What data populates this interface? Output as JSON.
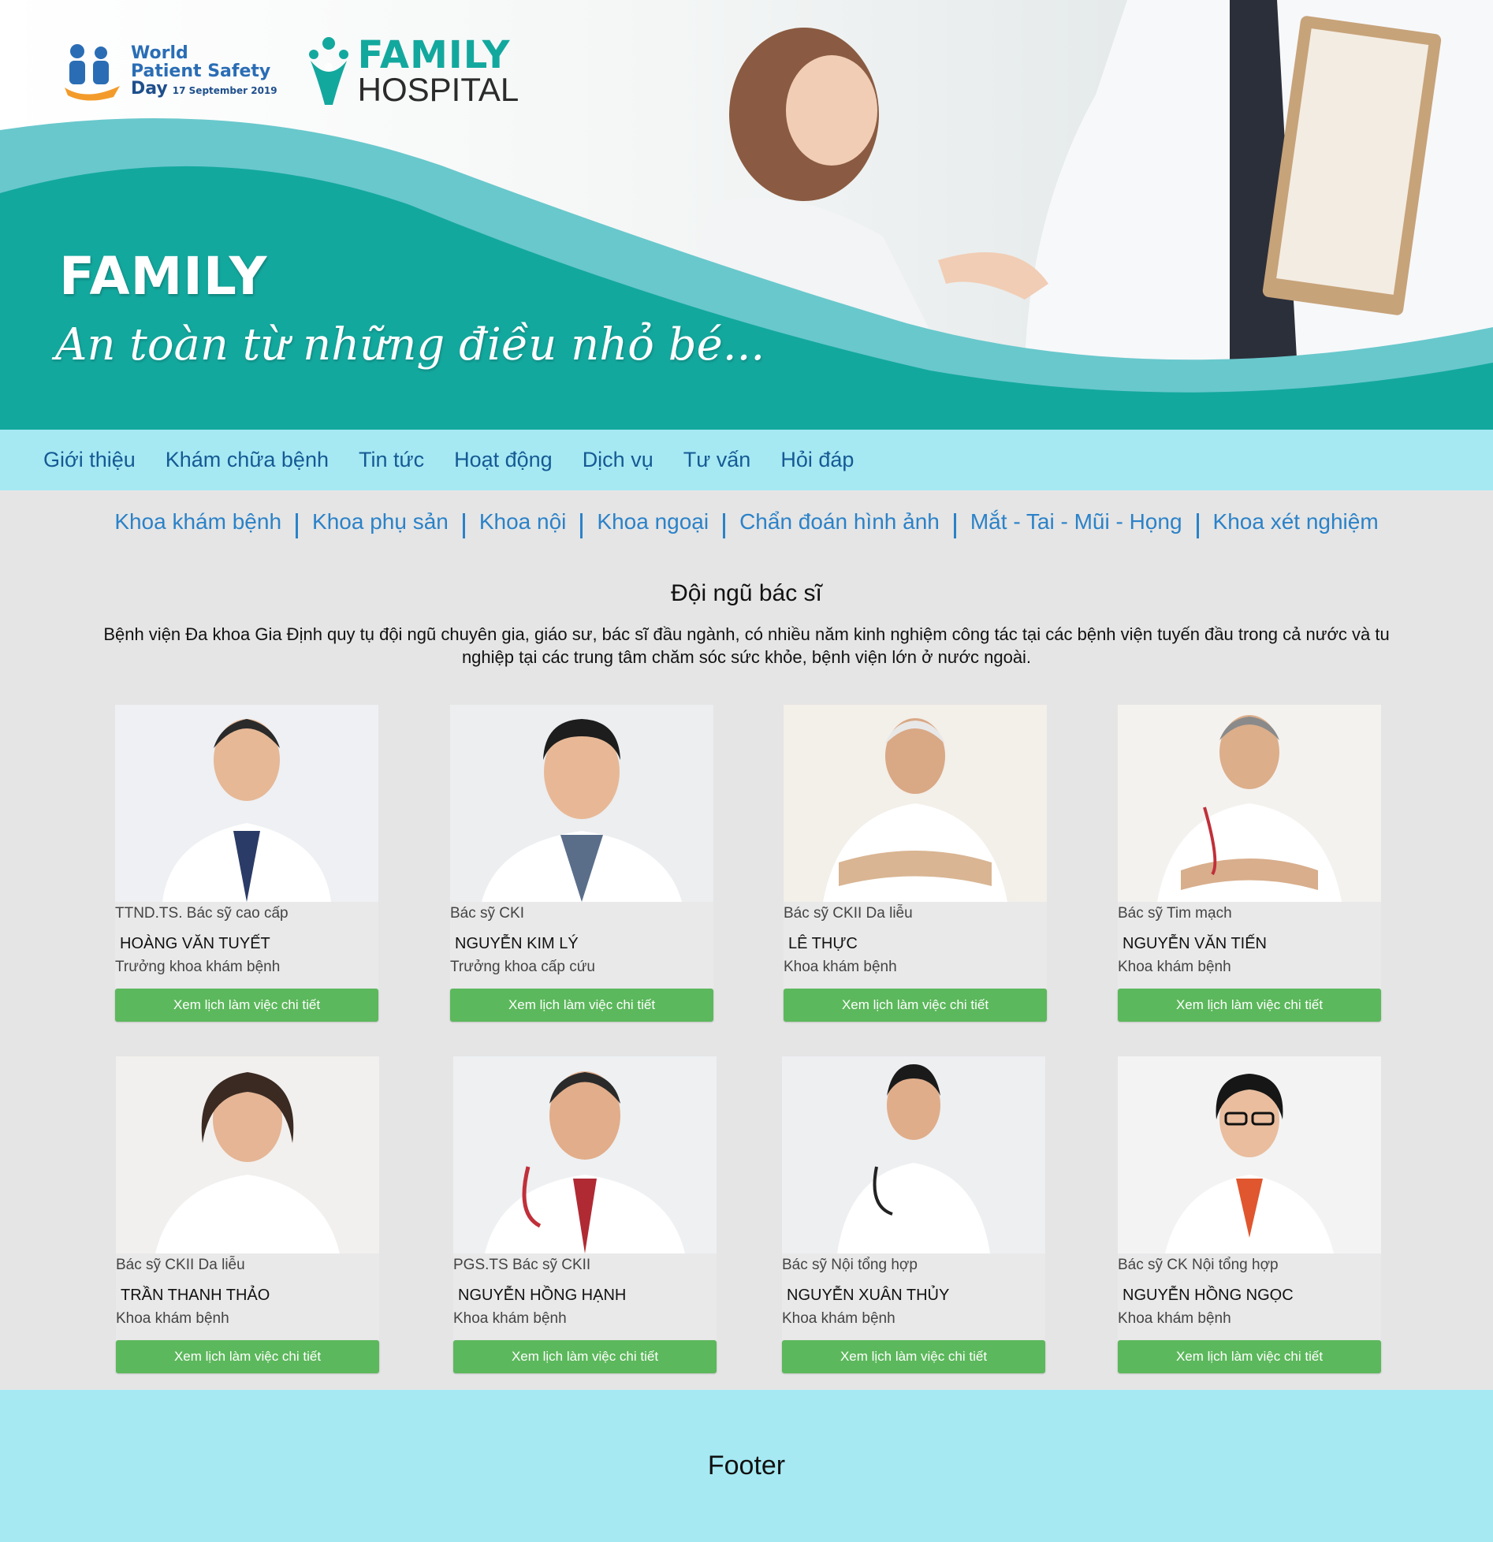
{
  "banner": {
    "wpsd": {
      "line1": "World",
      "line2": "Patient Safety",
      "line3": "Day",
      "date": "17 September 2019"
    },
    "hospital": {
      "line1": "FAMILY",
      "line2": "HOSPITAL"
    },
    "slogan_title": "FAMILY",
    "slogan_script": "An toàn từ những điều nhỏ bé...",
    "colors": {
      "teal": "#13a89e",
      "light_teal": "#69c8cc"
    }
  },
  "nav": {
    "items": [
      "Giới thiệu",
      "Khám chữa bệnh",
      "Tin tức",
      "Hoạt động",
      "Dịch vụ",
      "Tư vấn",
      "Hỏi đáp"
    ]
  },
  "departments": [
    "Khoa khám bệnh",
    "Khoa phụ sản",
    "Khoa nội",
    "Khoa ngoại",
    "Chẩn đoán hình ảnh",
    "Mắt - Tai - Mũi - Họng",
    "Khoa xét nghiệm"
  ],
  "section": {
    "title": "Đội ngũ bác sĩ",
    "intro": "Bệnh viện Đa khoa Gia Định quy tụ đội ngũ chuyên gia, giáo sư, bác sĩ đầu ngành, có nhiều năm kinh nghiệm công tác tại các bệnh viện tuyến đầu trong cả nước và tu nghiệp tại các trung tâm chăm sóc sức khỏe, bệnh viện lớn ở nước ngoài."
  },
  "doctors": [
    {
      "title": "TTND.TS. Bác sỹ cao cấp",
      "name": "HOÀNG VĂN TUYẾT",
      "dept": "Trưởng khoa khám bệnh",
      "button": "Xem lịch làm việc chi tiết"
    },
    {
      "title": "Bác sỹ CKI",
      "name": "NGUYỄN KIM LÝ",
      "dept": "Trưởng khoa cấp cứu",
      "button": "Xem lịch làm việc chi tiết"
    },
    {
      "title": "Bác sỹ CKII Da liễu",
      "name": "LÊ THỰC",
      "dept": "Khoa khám bệnh",
      "button": "Xem lịch làm việc chi tiết"
    },
    {
      "title": "Bác sỹ Tim mạch",
      "name": "NGUYỄN VĂN TIẾN",
      "dept": "Khoa khám bệnh",
      "button": "Xem lịch làm việc chi tiết"
    },
    {
      "title": "Bác sỹ CKII Da liễu",
      "name": "TRẦN THANH THẢO",
      "dept": "Khoa khám bệnh",
      "button": "Xem lịch làm việc chi tiết"
    },
    {
      "title": "PGS.TS Bác sỹ CKII",
      "name": "NGUYỄN HỒNG HẠNH",
      "dept": "Khoa khám bệnh",
      "button": "Xem lịch làm việc chi tiết"
    },
    {
      "title": "Bác sỹ Nội tổng hợp",
      "name": "NGUYỄN XUÂN THỦY",
      "dept": "Khoa khám bệnh",
      "button": "Xem lịch làm việc chi tiết"
    },
    {
      "title": "Bác sỹ CK Nội tổng hợp",
      "name": "NGUYỄN HỒNG NGỌC",
      "dept": "Khoa khám bệnh",
      "button": "Xem lịch làm việc chi tiết"
    }
  ],
  "footer": {
    "label": "Footer"
  },
  "colors": {
    "nav_bg": "#a6e9f3",
    "button_green": "#5cb85c",
    "link_blue": "#2b82c8"
  }
}
